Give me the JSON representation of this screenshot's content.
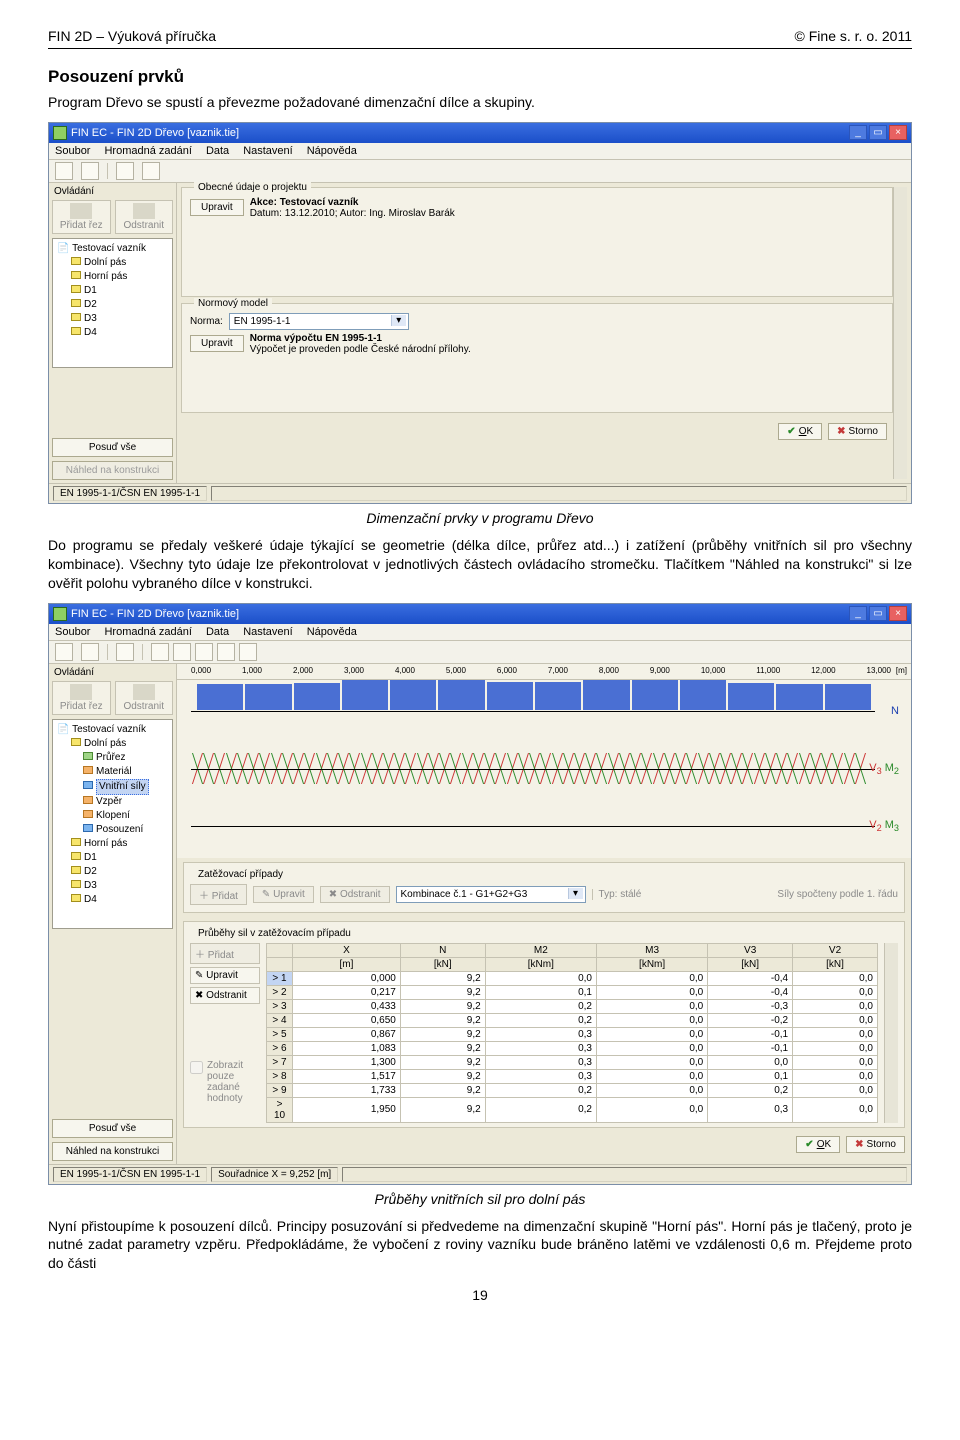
{
  "header": {
    "left": "FIN 2D – Výuková příručka",
    "right": "© Fine s. r. o. 2011"
  },
  "section_title": "Posouzení prvků",
  "intro": "Program Dřevo se spustí a převezme požadované dimenzační dílce a skupiny.",
  "caption1": "Dimenzační prvky v programu Dřevo",
  "para1": "Do programu se předaly veškeré údaje týkající se geometrie (délka dílce, průřez atd...) i zatížení (průběhy vnitřních sil pro všechny kombinace). Všechny tyto údaje lze překontrolovat v jednotlivých částech ovládacího stromečku. Tlačítkem \"Náhled na konstrukci\" si lze ověřit polohu vybraného dílce v konstrukci.",
  "caption2": "Průběhy vnitřních sil pro dolní pás",
  "para2": "Nyní přistoupíme k posouzení dílců. Principy posuzování si předvedeme na dimenzační skupině \"Horní pás\". Horní pás je tlačený, proto je nutné zadat parametry vzpěru. Předpokládáme, že vybočení z roviny vazníku bude bráněno latěmi ve vzdálenosti 0,6 m. Přejdeme proto do části",
  "page_num": "19",
  "app": {
    "title": "FIN EC - FIN 2D Dřevo [vaznik.tie]",
    "menu": [
      "Soubor",
      "Hromadná zadání",
      "Data",
      "Nastavení",
      "Nápověda"
    ],
    "side_head": "Ovládání",
    "side_btn_add": "Přidat řez",
    "side_btn_del": "Odstranit",
    "side_posoud": "Posuď vše",
    "side_nahled": "Náhled na konstrukci",
    "ok": "OK",
    "storno": "Storno"
  },
  "shot1": {
    "tree": [
      "Testovací vazník",
      "Dolní pás",
      "Horní pás",
      "D1",
      "D2",
      "D3",
      "D4"
    ],
    "panel1_title": "Obecné údaje o projektu",
    "btn_upravit": "Upravit",
    "akce": "Akce: Testovací vazník",
    "datum": "Datum: 13.12.2010;   Autor: Ing. Miroslav Barák",
    "panel2_title": "Normový model",
    "norma_lbl": "Norma:",
    "norma_val": "EN 1995-1-1",
    "norma_line1": "Norma výpočtu EN 1995-1-1",
    "norma_line2": "Výpočet je proveden podle České národní přílohy.",
    "status_left": "EN 1995-1-1/ČSN EN 1995-1-1"
  },
  "shot2": {
    "tree": [
      "Testovací vazník",
      "Dolní pás",
      "Průřez",
      "Materiál",
      "Vnitřní síly",
      "Vzpěr",
      "Klopení",
      "Posouzení",
      "Horní pás",
      "D1",
      "D2",
      "D3",
      "D4"
    ],
    "ruler_unit": "[m]",
    "panel_zp_title": "Zatěžovací případy",
    "zp_pridat": "Přidat",
    "zp_upravit": "Upravit",
    "zp_odstranit": "Odstranit",
    "zp_combo": "Kombinace č.1 - G1+G2+G3",
    "zp_typ": "Typ: stálé",
    "zp_right": "Síly spočteny podle 1. řádu",
    "panel_pru_title": "Průběhy sil v zatěžovacím případu",
    "se_btns": [
      "Přidat",
      "Upravit",
      "Odstranit"
    ],
    "chk_label": "Zobrazit pouze zadané hodnoty",
    "status_left": "EN 1995-1-1/ČSN EN 1995-1-1",
    "status_coord": "Souřadnice X = 9,252 [m]",
    "right_labels": {
      "n": "N",
      "m": [
        "V",
        "3",
        " M",
        "2"
      ],
      "v": [
        "V",
        "2",
        " M",
        "3"
      ]
    },
    "table": {
      "headers": [
        "X",
        "N",
        "M2",
        "M3",
        "V3",
        "V2"
      ],
      "units": [
        "[m]",
        "[kN]",
        "[kNm]",
        "[kNm]",
        "[kN]",
        "[kN]"
      ],
      "rows": [
        [
          "1",
          "0,000",
          "9,2",
          "0,0",
          "0,0",
          "-0,4",
          "0,0"
        ],
        [
          "2",
          "0,217",
          "9,2",
          "0,1",
          "0,0",
          "-0,4",
          "0,0"
        ],
        [
          "3",
          "0,433",
          "9,2",
          "0,2",
          "0,0",
          "-0,3",
          "0,0"
        ],
        [
          "4",
          "0,650",
          "9,2",
          "0,2",
          "0,0",
          "-0,2",
          "0,0"
        ],
        [
          "5",
          "0,867",
          "9,2",
          "0,3",
          "0,0",
          "-0,1",
          "0,0"
        ],
        [
          "6",
          "1,083",
          "9,2",
          "0,3",
          "0,0",
          "-0,1",
          "0,0"
        ],
        [
          "7",
          "1,300",
          "9,2",
          "0,3",
          "0,0",
          "0,0",
          "0,0"
        ],
        [
          "8",
          "1,517",
          "9,2",
          "0,3",
          "0,0",
          "0,1",
          "0,0"
        ],
        [
          "9",
          "1,733",
          "9,2",
          "0,2",
          "0,0",
          "0,2",
          "0,0"
        ],
        [
          "10",
          "1,950",
          "9,2",
          "0,2",
          "0,0",
          "0,3",
          "0,0"
        ]
      ]
    }
  },
  "chart_data": [
    {
      "type": "bar",
      "title": "N – normálová síla [kN] (dolní pás)",
      "x": [
        0,
        1,
        2,
        3,
        4,
        5,
        6,
        7,
        8,
        9,
        10,
        11,
        12,
        13
      ],
      "values": [
        0.19,
        0.19,
        0.2,
        0.22,
        0.22,
        0.22,
        0.21,
        0.21,
        0.22,
        0.22,
        0.22,
        0.2,
        0.19,
        0.19
      ],
      "xlabel": "x [m]",
      "ylabel": "N [kN]",
      "ylim": [
        0,
        0.25
      ]
    },
    {
      "type": "line",
      "title": "V3 / M2 – obálky vnitřních sil",
      "series": [
        {
          "name": "V3",
          "values": [
            -0.4,
            -0.3,
            -0.2,
            -0.1,
            0,
            0.1,
            0.2,
            0.3,
            0.4,
            0.3,
            0.2,
            0.1,
            0,
            -0.1
          ]
        },
        {
          "name": "M2",
          "values": [
            0,
            0.1,
            0.2,
            0.3,
            0.3,
            0.3,
            0.3,
            0.2,
            0.2,
            0.1,
            0.1,
            0.1,
            0,
            0
          ]
        }
      ],
      "x": [
        0,
        1,
        2,
        3,
        4,
        5,
        6,
        7,
        8,
        9,
        10,
        11,
        12,
        13
      ],
      "xlabel": "x [m]",
      "ylabel": "",
      "ylim": [
        -0.5,
        0.5
      ]
    },
    {
      "type": "line",
      "title": "V2 / M3",
      "series": [
        {
          "name": "V2",
          "values": [
            0,
            0,
            0,
            0,
            0,
            0,
            0,
            0,
            0,
            0,
            0,
            0,
            0,
            0
          ]
        },
        {
          "name": "M3",
          "values": [
            0,
            0,
            0,
            0,
            0,
            0,
            0,
            0,
            0,
            0,
            0,
            0,
            0,
            0
          ]
        }
      ],
      "x": [
        0,
        1,
        2,
        3,
        4,
        5,
        6,
        7,
        8,
        9,
        10,
        11,
        12,
        13
      ],
      "xlabel": "x [m]",
      "ylabel": "",
      "ylim": [
        -0.1,
        0.1
      ]
    }
  ]
}
